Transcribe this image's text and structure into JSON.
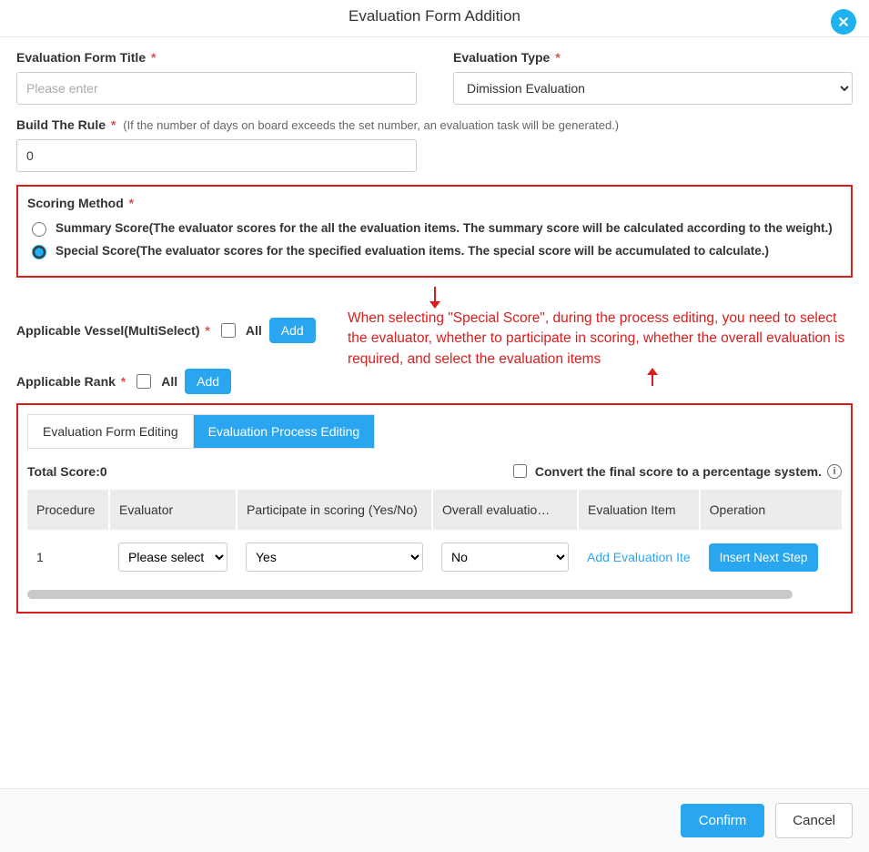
{
  "header": {
    "title": "Evaluation Form Addition"
  },
  "fields": {
    "form_title": {
      "label": "Evaluation Form Title",
      "placeholder": "Please enter",
      "value": ""
    },
    "eval_type": {
      "label": "Evaluation Type",
      "selected": "Dimission Evaluation"
    },
    "build_rule": {
      "label": "Build The Rule",
      "hint": "(If the number of days on board exceeds the set number, an evaluation task will be generated.)",
      "value": "0"
    },
    "applicable_vessel": {
      "label": "Applicable Vessel(MultiSelect)",
      "all_label": "All",
      "add_label": "Add"
    },
    "applicable_rank": {
      "label": "Applicable Rank",
      "all_label": "All",
      "add_label": "Add"
    }
  },
  "scoring": {
    "title": "Scoring Method",
    "summary": "Summary Score(The evaluator scores for the all the evaluation items. The summary score will be calculated according to the weight.)",
    "special": "Special Score(The evaluator scores for the specified evaluation items. The special score will be accumulated to calculate.)"
  },
  "annotation": "When selecting \"Special Score\", during the process editing, you need to select the evaluator, whether to participate in scoring, whether the overall evaluation is required, and select the evaluation items",
  "tabs": {
    "form_editing": "Evaluation Form Editing",
    "process_editing": "Evaluation Process Editing"
  },
  "process": {
    "total_label": "Total Score:",
    "total_value": "0",
    "convert_label": "Convert the final score to a percentage system.",
    "columns": {
      "procedure": "Procedure",
      "evaluator": "Evaluator",
      "participate": "Participate in scoring (Yes/No)",
      "overall": "Overall evaluatio…",
      "item": "Evaluation Item",
      "operation": "Operation"
    },
    "row": {
      "procedure": "1",
      "evaluator": "Please select",
      "participate": "Yes",
      "overall": "No",
      "add_item": "Add Evaluation Ite",
      "insert": "Insert Next Step"
    }
  },
  "footer": {
    "confirm": "Confirm",
    "cancel": "Cancel"
  }
}
